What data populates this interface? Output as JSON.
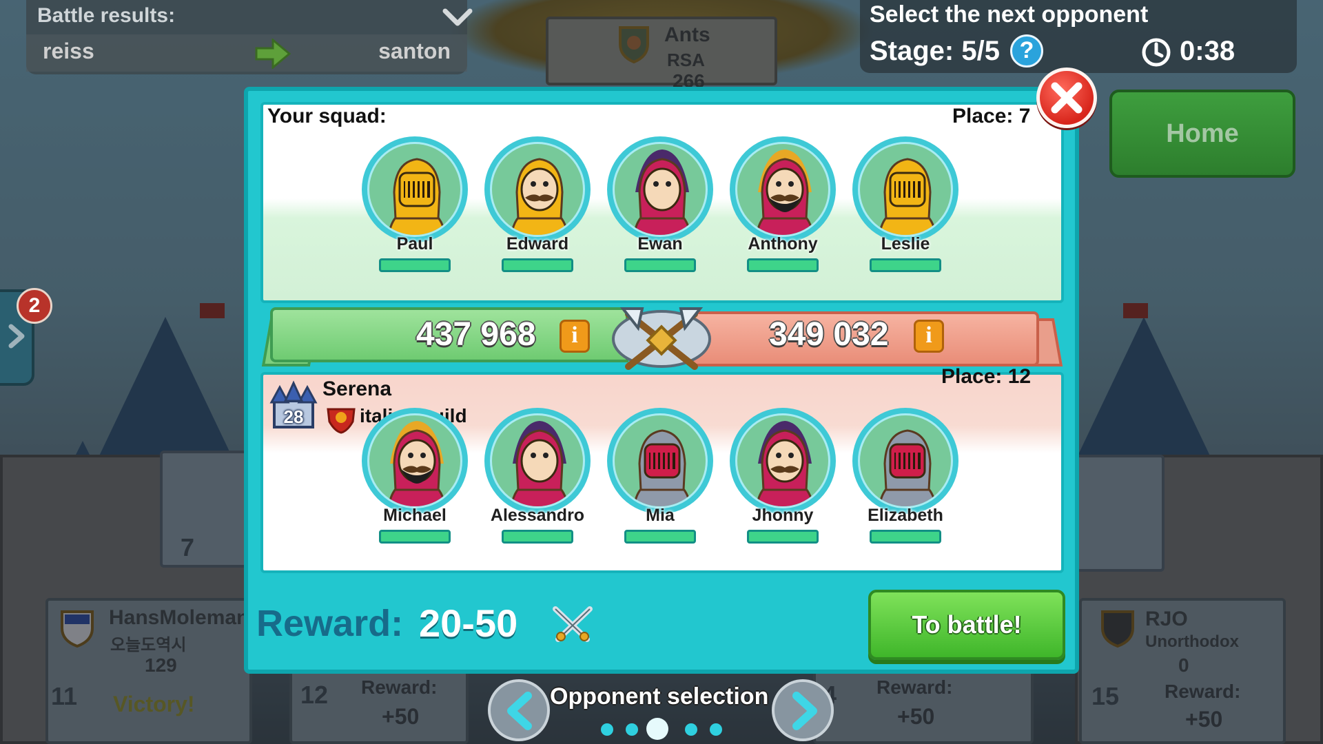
{
  "battle_results": {
    "title": "Battle results:",
    "player_left": "reiss",
    "player_right": "santon"
  },
  "top_guild": {
    "name": "Ants",
    "region": "RSA",
    "score": "266"
  },
  "header": {
    "title": "Select the next opponent",
    "stage": "Stage: 5/5",
    "help": "?",
    "timer": "0:38"
  },
  "home_button": "Home",
  "side_badge": "2",
  "squad": {
    "title": "Your squad:",
    "place": "Place: 7",
    "power": "437 968",
    "heroes": [
      {
        "name": "Paul",
        "type": "gold-knight"
      },
      {
        "name": "Edward",
        "type": "gold-hood-mustache"
      },
      {
        "name": "Ewan",
        "type": "red-mage"
      },
      {
        "name": "Anthony",
        "type": "red-hood-beard"
      },
      {
        "name": "Leslie",
        "type": "gold-knight"
      }
    ]
  },
  "enemy": {
    "name": "Serena",
    "guild": "italian guild",
    "castle_level": "28",
    "place": "Place: 12",
    "power": "349 032",
    "heroes": [
      {
        "name": "Michael",
        "type": "red-hood-beard"
      },
      {
        "name": "Alessandro",
        "type": "red-mage"
      },
      {
        "name": "Mia",
        "type": "red-knight"
      },
      {
        "name": "Jhonny",
        "type": "red-mage-mustache"
      },
      {
        "name": "Elizabeth",
        "type": "red-knight"
      }
    ]
  },
  "reward": {
    "label": "Reward:",
    "value": "20-50"
  },
  "battle_button": "To battle!",
  "opponent_selection": {
    "title": "Opponent selection",
    "dots_total": 5,
    "active_index": 2
  },
  "bg_plates": [
    {
      "num": "11",
      "name": "HansMoleman",
      "sub": "오늘도역시",
      "score": "129",
      "status": "Victory!"
    },
    {
      "num": "12",
      "reward_label": "Reward:",
      "reward": "+50"
    },
    {
      "num": "4",
      "reward_label": "Reward:",
      "reward": "+50"
    },
    {
      "num": "15",
      "name": "RJO",
      "sub": "Unorthodox",
      "score": "0",
      "reward_label": "Reward:",
      "reward": "+50"
    },
    {
      "num": "7"
    }
  ],
  "colors": {
    "modal": "#22c7cf",
    "ally_ribbon": "#6fcb72",
    "enemy_ribbon": "#e98d78",
    "battle_button": "#3fb62a",
    "close_button": "#d8261c"
  }
}
